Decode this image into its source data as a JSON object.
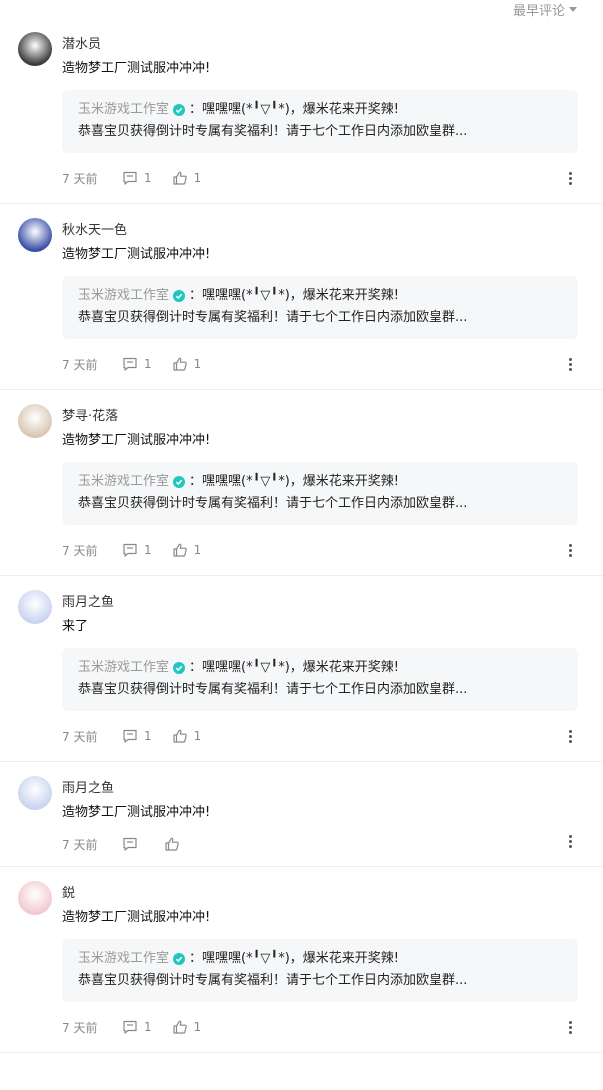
{
  "sort": {
    "label": "最早评论"
  },
  "comments": [
    {
      "username": "潜水员",
      "content": "造物梦工厂测试服冲冲冲!",
      "reply": {
        "author": "玉米游戏工作室",
        "text": "：嘿嘿嘿(*╹▽╹*)，爆米花来开奖辣!",
        "detail": "恭喜宝贝获得倒计时专属有奖福利！请于七个工作日内添加欧皇群..."
      },
      "time": "7 天前",
      "reply_count": "1",
      "like_count": "1",
      "avatar_color": "#3b3b3b"
    },
    {
      "username": "秋水天一色",
      "content": "造物梦工厂测试服冲冲冲!",
      "reply": {
        "author": "玉米游戏工作室",
        "text": "：嘿嘿嘿(*╹▽╹*)，爆米花来开奖辣!",
        "detail": "恭喜宝贝获得倒计时专属有奖福利！请于七个工作日内添加欧皇群..."
      },
      "time": "7 天前",
      "reply_count": "1",
      "like_count": "1",
      "avatar_color": "#3a4fa8"
    },
    {
      "username": "梦寻·花落",
      "content": "造物梦工厂测试服冲冲冲!",
      "reply": {
        "author": "玉米游戏工作室",
        "text": "：嘿嘿嘿(*╹▽╹*)，爆米花来开奖辣!",
        "detail": "恭喜宝贝获得倒计时专属有奖福利！请于七个工作日内添加欧皇群..."
      },
      "time": "7 天前",
      "reply_count": "1",
      "like_count": "1",
      "avatar_color": "#d9c7b4"
    },
    {
      "username": "雨月之鱼",
      "content": "来了",
      "reply": {
        "author": "玉米游戏工作室",
        "text": "：嘿嘿嘿(*╹▽╹*)，爆米花来开奖辣!",
        "detail": "恭喜宝贝获得倒计时专属有奖福利！请于七个工作日内添加欧皇群..."
      },
      "time": "7 天前",
      "reply_count": "1",
      "like_count": "1",
      "avatar_color": "#c9d4ef"
    },
    {
      "username": "雨月之鱼",
      "content": "造物梦工厂测试服冲冲冲!",
      "reply": null,
      "time": "7 天前",
      "reply_count": "",
      "like_count": "",
      "avatar_color": "#c9d4ef"
    },
    {
      "username": "鋭",
      "content": "造物梦工厂测试服冲冲冲!",
      "reply": {
        "author": "玉米游戏工作室",
        "text": "：嘿嘿嘿(*╹▽╹*)，爆米花来开奖辣!",
        "detail": "恭喜宝贝获得倒计时专属有奖福利！请于七个工作日内添加欧皇群..."
      },
      "time": "7 天前",
      "reply_count": "1",
      "like_count": "1",
      "avatar_color": "#f2c9d2"
    }
  ],
  "colors": {
    "verified": "#1fc7c0",
    "muted": "#999999"
  }
}
